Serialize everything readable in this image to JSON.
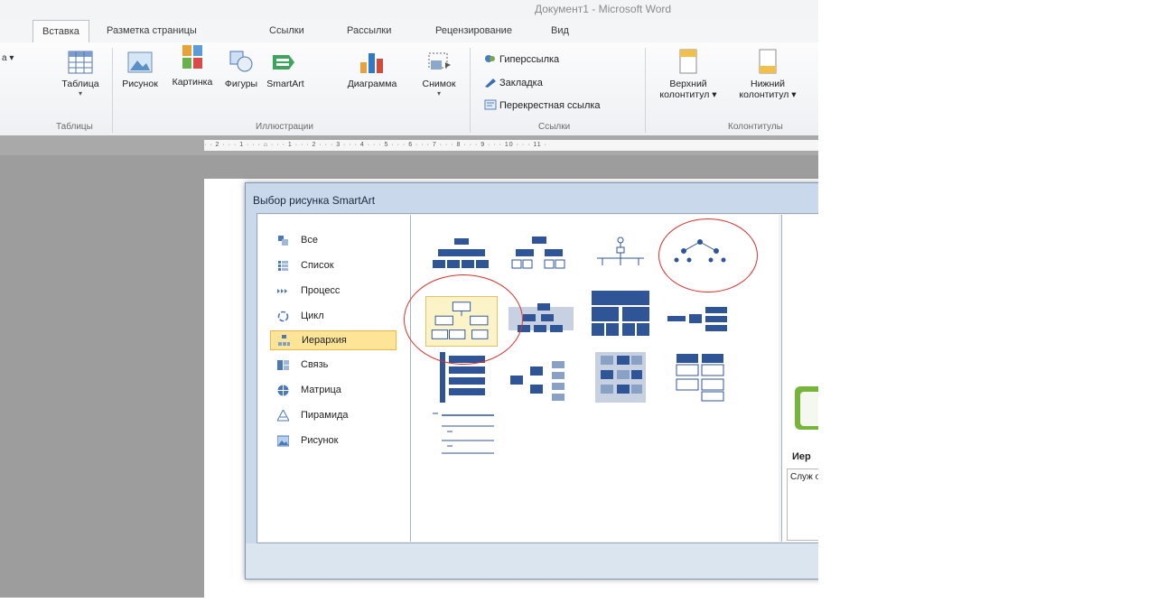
{
  "window": {
    "title": "Документ1 - Microsoft Word"
  },
  "tabs": [
    {
      "label": "Вставка",
      "active": true
    },
    {
      "label": "Разметка страницы",
      "active": false
    },
    {
      "label": "Ссылки",
      "active": false
    },
    {
      "label": "Рассылки",
      "active": false
    },
    {
      "label": "Рецензирование",
      "active": false
    },
    {
      "label": "Вид",
      "active": false
    }
  ],
  "ribbon": {
    "left_stub": "а ▾",
    "tables": {
      "button": "Таблица",
      "group": "Таблицы"
    },
    "illustrations": {
      "buttons": [
        "Рисунок",
        "Картинка",
        "Фигуры",
        "SmartArt",
        "Диаграмма",
        "Снимок"
      ],
      "group": "Иллюстрации"
    },
    "links": {
      "items": [
        "Гиперссылка",
        "Закладка",
        "Перекрестная ссылка"
      ],
      "group": "Ссылки"
    },
    "headers": {
      "buttons": [
        {
          "line1": "Верхний",
          "line2": "колонтитул ▾"
        },
        {
          "line1": "Нижний",
          "line2": "колонтитул ▾"
        }
      ],
      "group": "Колонтитулы"
    }
  },
  "ruler": {
    "text": "· · 2 · · · 1 · · · ⌂ · · · 1 · · · 2 · · · 3 · · · 4 · · · 5 · · · 6 · · · 7 · · · 8 · · · 9 · · · 10 · · · 11 ·"
  },
  "dialog": {
    "title": "Выбор рисунка SmartArt",
    "categories": [
      {
        "label": "Все",
        "icon": "all-icon"
      },
      {
        "label": "Список",
        "icon": "list-icon"
      },
      {
        "label": "Процесс",
        "icon": "process-icon"
      },
      {
        "label": "Цикл",
        "icon": "cycle-icon"
      },
      {
        "label": "Иерархия",
        "icon": "hierarchy-icon",
        "selected": true
      },
      {
        "label": "Связь",
        "icon": "relationship-icon"
      },
      {
        "label": "Матрица",
        "icon": "matrix-icon"
      },
      {
        "label": "Пирамида",
        "icon": "pyramid-icon"
      },
      {
        "label": "Рисунок",
        "icon": "picture-icon"
      }
    ],
    "description": {
      "title": "Иер",
      "text": "Служ отно"
    },
    "highlight_color": "#d8322d",
    "accent_color": "#2f5597"
  }
}
